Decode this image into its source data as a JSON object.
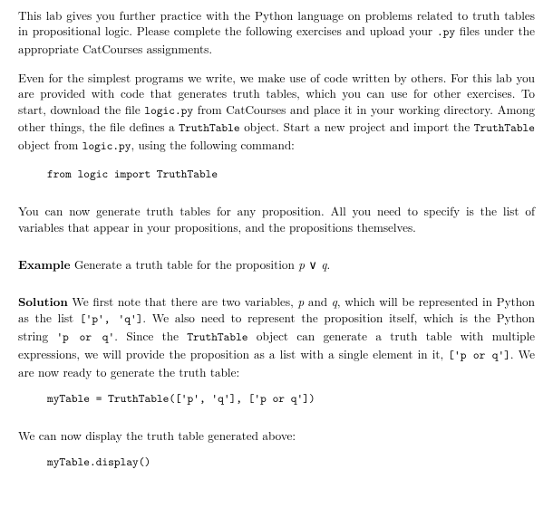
{
  "p1_a": "This lab gives you further practice with the Python language on problems related to truth tables in propositional logic. Please complete the following exercises and upload your ",
  "p1_code1": ".py",
  "p1_b": " files under the appropriate CatCourses assignments.",
  "p2_a": "Even for the simplest programs we write, we make use of code written by others. For this lab you are provided with code that generates truth tables, which you can use for other exercises. To start, download the file ",
  "p2_code1": "logic.py",
  "p2_b": " from CatCourses and place it in your working directory. Among other things, the file defines a ",
  "p2_code2": "TruthTable",
  "p2_c": " object. Start a new project and import the ",
  "p2_code3": "TruthTable",
  "p2_d": " object from ",
  "p2_code4": "logic.py",
  "p2_e": ", using the following command:",
  "code1": "from logic import TruthTable",
  "p3": "You can now generate truth tables for any proposition. All you need to specify is the list of variables that appear in your propositions, and the propositions themselves.",
  "ex_label": "Example",
  "ex_a": "   Generate a truth table for the proposition ",
  "ex_math_p": "p",
  "ex_math_or": " ∨ ",
  "ex_math_q": "q",
  "ex_b": ".",
  "sol_label": "Solution",
  "sol_a": "   We first note that there are two variables, ",
  "sol_math_p": "p",
  "sol_b": " and ",
  "sol_math_q": "q",
  "sol_c": ", which will be represented in Python as the list ",
  "sol_code1": "['p', 'q']",
  "sol_d": ". We also need to represent the proposition itself, which is the Python string ",
  "sol_code2": "'p or q'",
  "sol_e": ". Since the ",
  "sol_code3": "TruthTable",
  "sol_f": " object can generate a truth table with multiple expressions, we will provide the proposition as a list with a single element in it, ",
  "sol_code4": "['p or q']",
  "sol_g": ". We are now ready to generate the truth table:",
  "code2": "myTable = TruthTable(['p', 'q'], ['p or q'])",
  "p4": "We can now display the truth table generated above:",
  "code3": "myTable.display()"
}
